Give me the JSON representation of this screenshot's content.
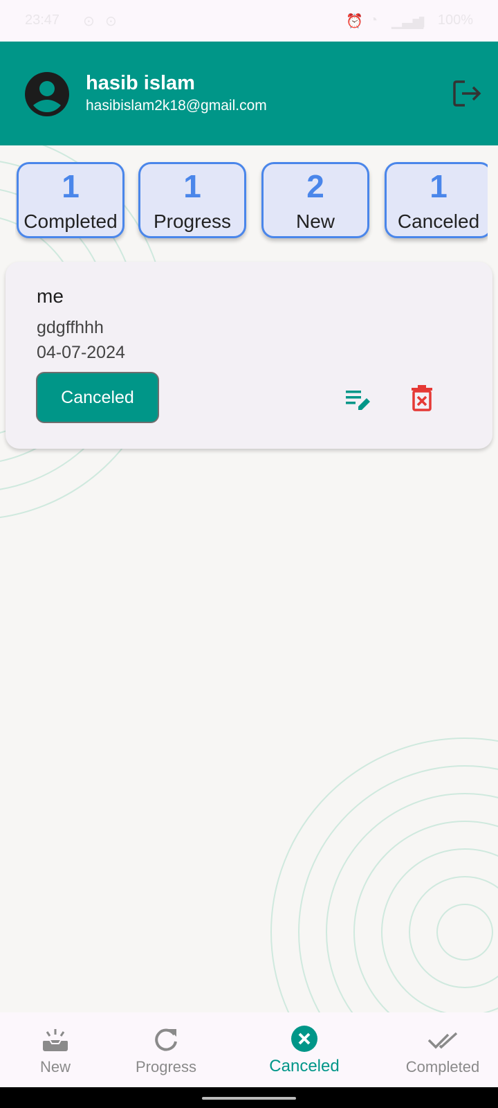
{
  "status_bar": {
    "time": "23:47",
    "battery": "100%"
  },
  "header": {
    "name": "hasib islam",
    "email": "hasibislam2k18@gmail.com"
  },
  "summary": [
    {
      "count": "1",
      "label": "Completed"
    },
    {
      "count": "1",
      "label": "Progress"
    },
    {
      "count": "2",
      "label": "New"
    },
    {
      "count": "1",
      "label": "Canceled"
    }
  ],
  "tasks": [
    {
      "title": "me",
      "description": "gdgffhhh",
      "date": "04-07-2024",
      "status": "Canceled"
    }
  ],
  "bottom_nav": {
    "active": "Canceled",
    "items": [
      {
        "label": "New",
        "icon": "new-task-icon"
      },
      {
        "label": "Progress",
        "icon": "refresh-icon"
      },
      {
        "label": "Canceled",
        "icon": "cancel-circle-icon"
      },
      {
        "label": "Completed",
        "icon": "double-check-icon"
      }
    ]
  },
  "colors": {
    "primary": "#009688",
    "summary_accent": "#4a86ea",
    "summary_bg": "#e2e6f8",
    "delete": "#e53935",
    "nav_inactive": "#8a8a8a"
  }
}
